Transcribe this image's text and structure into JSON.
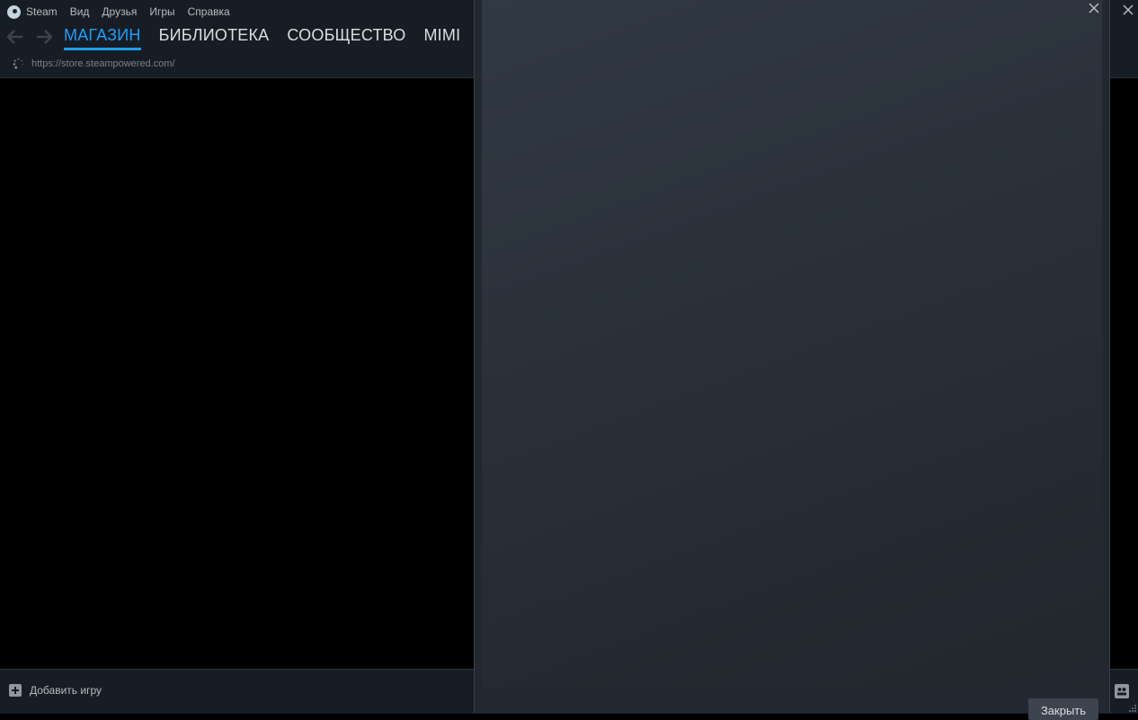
{
  "menubar": {
    "app_name": "Steam",
    "items": [
      "Вид",
      "Друзья",
      "Игры",
      "Справка"
    ]
  },
  "nav": {
    "tabs": [
      "МАГАЗИН",
      "БИБЛИОТЕКА",
      "СООБЩЕСТВО",
      "MIMI"
    ],
    "active_tab": 0
  },
  "url": "https://store.steampowered.com/",
  "bottombar": {
    "add_game_label": "Добавить игру"
  },
  "dialog": {
    "close_button_label": "Закрыть"
  },
  "colors": {
    "accent": "#1a9fff",
    "chrome_bg": "#171d25",
    "dialog_bg": "#2b323c"
  },
  "icons": {
    "steam": "steam-logo-icon",
    "back": "arrow-left-icon",
    "forward": "arrow-right-icon",
    "loading": "spinner-icon",
    "close": "close-icon",
    "add": "plus-icon",
    "friends": "friends-icon"
  }
}
